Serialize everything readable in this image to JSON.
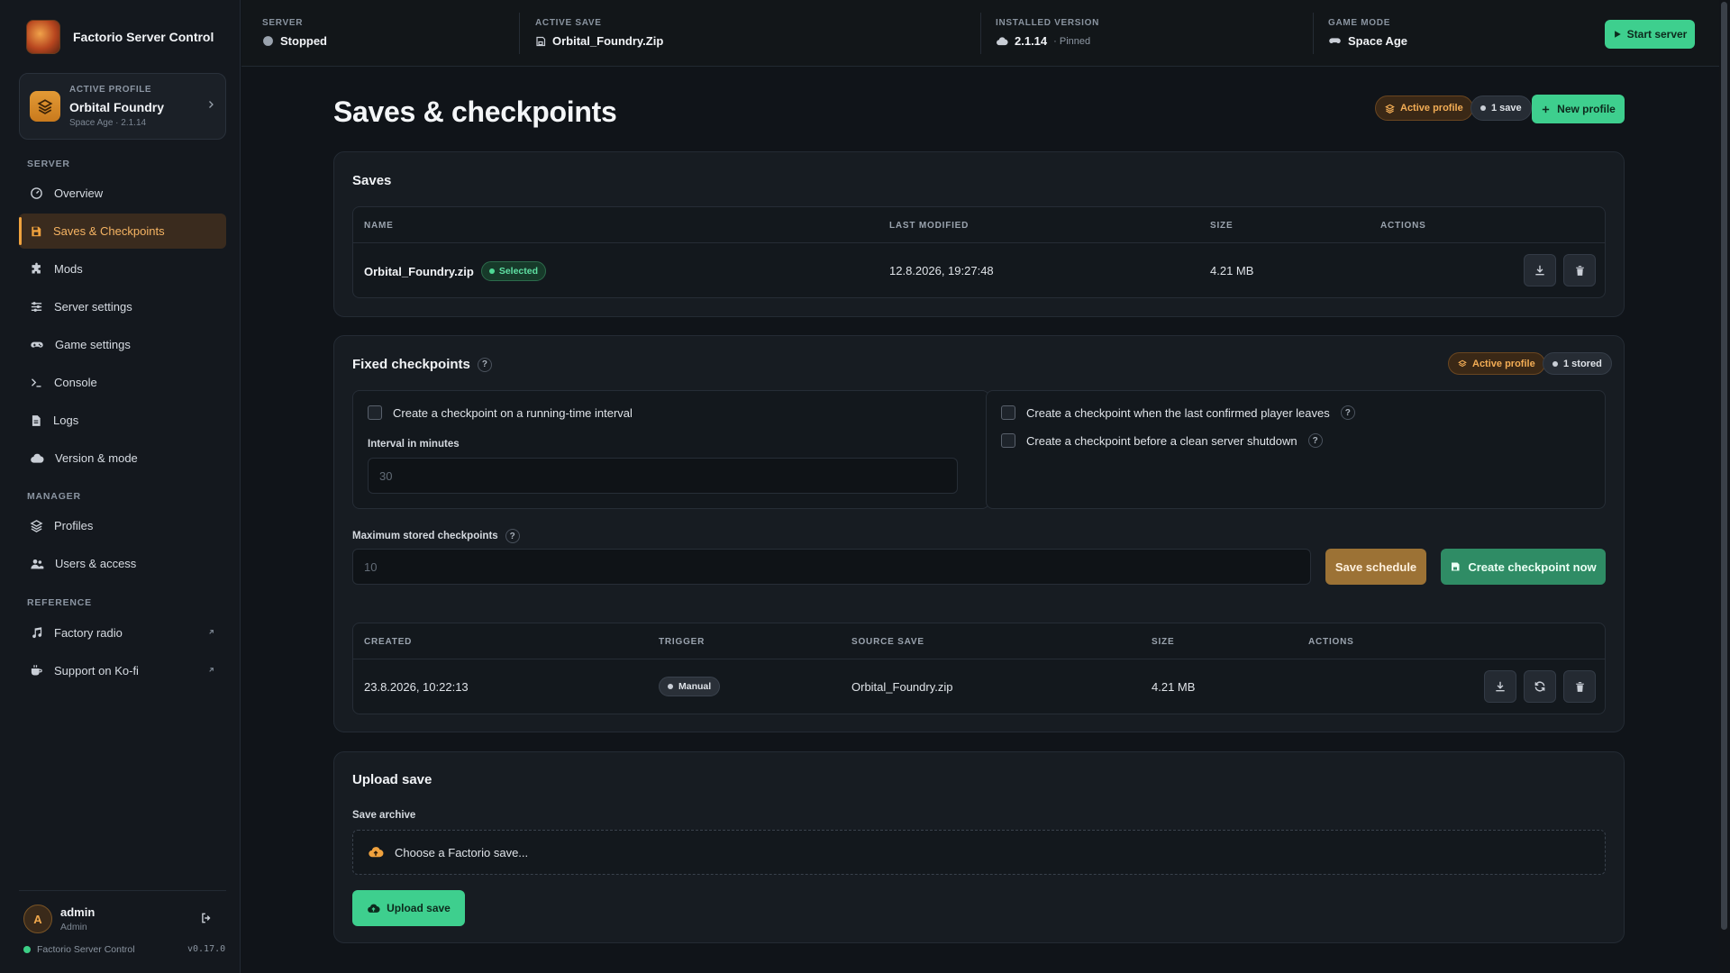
{
  "app": {
    "title": "Factorio Server Control",
    "version": "v0.17.0",
    "footer_label": "Factorio Server Control"
  },
  "profile": {
    "kicker": "ACTIVE PROFILE",
    "name": "Orbital Foundry",
    "subtitle": "Space Age · 2.1.14"
  },
  "nav": {
    "server_heading": "SERVER",
    "manager_heading": "MANAGER",
    "reference_heading": "REFERENCE",
    "items": [
      {
        "label": "Overview"
      },
      {
        "label": "Saves & Checkpoints"
      },
      {
        "label": "Mods"
      },
      {
        "label": "Server settings"
      },
      {
        "label": "Game settings"
      },
      {
        "label": "Console"
      },
      {
        "label": "Logs"
      },
      {
        "label": "Version & mode"
      },
      {
        "label": "Profiles"
      },
      {
        "label": "Users & access"
      },
      {
        "label": "Factory radio"
      },
      {
        "label": "Support on Ko-fi"
      }
    ]
  },
  "user": {
    "initial": "A",
    "name": "admin",
    "role": "Admin"
  },
  "topbar": {
    "server_label": "SERVER",
    "server_value": "Stopped",
    "save_label": "ACTIVE SAVE",
    "save_value": "Orbital_Foundry.Zip",
    "version_label": "INSTALLED VERSION",
    "version_value": "2.1.14",
    "version_note": "· Pinned",
    "mode_label": "GAME MODE",
    "mode_value": "Space Age",
    "start_label": "Start server"
  },
  "page": {
    "title": "Saves & checkpoints",
    "pill_active_profile": "Active profile",
    "pill_saves": "1 save",
    "new_profile_label": "New profile"
  },
  "saves": {
    "title": "Saves",
    "columns": [
      "NAME",
      "LAST MODIFIED",
      "SIZE",
      "ACTIONS"
    ],
    "rows": [
      {
        "name": "Orbital_Foundry.zip",
        "tag": "Selected",
        "modified": "12.8.2026, 19:27:48",
        "size": "4.21 MB"
      }
    ]
  },
  "checkpoints": {
    "title": "Fixed checkpoints",
    "pill_active_profile": "Active profile",
    "pill_stored": "1 stored",
    "interval_check": "Create a checkpoint on a running-time interval",
    "interval_label": "Interval in minutes",
    "interval_placeholder": "30",
    "player_leaves_check": "Create a checkpoint when the last confirmed player leaves",
    "shutdown_check": "Create a checkpoint before a clean server shutdown",
    "max_label": "Maximum stored checkpoints",
    "max_placeholder": "10",
    "save_schedule_label": "Save schedule",
    "create_now_label": "Create checkpoint now",
    "columns": [
      "CREATED",
      "TRIGGER",
      "SOURCE SAVE",
      "SIZE",
      "ACTIONS"
    ],
    "rows": [
      {
        "created": "23.8.2026, 10:22:13",
        "trigger": "Manual",
        "source": "Orbital_Foundry.zip",
        "size": "4.21 MB"
      }
    ]
  },
  "upload": {
    "title": "Upload save",
    "field_label": "Save archive",
    "file_prompt": "Choose a Factorio save...",
    "button_label": "Upload save"
  },
  "colors": {
    "accent_green": "#3ecf8e",
    "accent_amber": "#f0a23e",
    "background": "#101419"
  }
}
